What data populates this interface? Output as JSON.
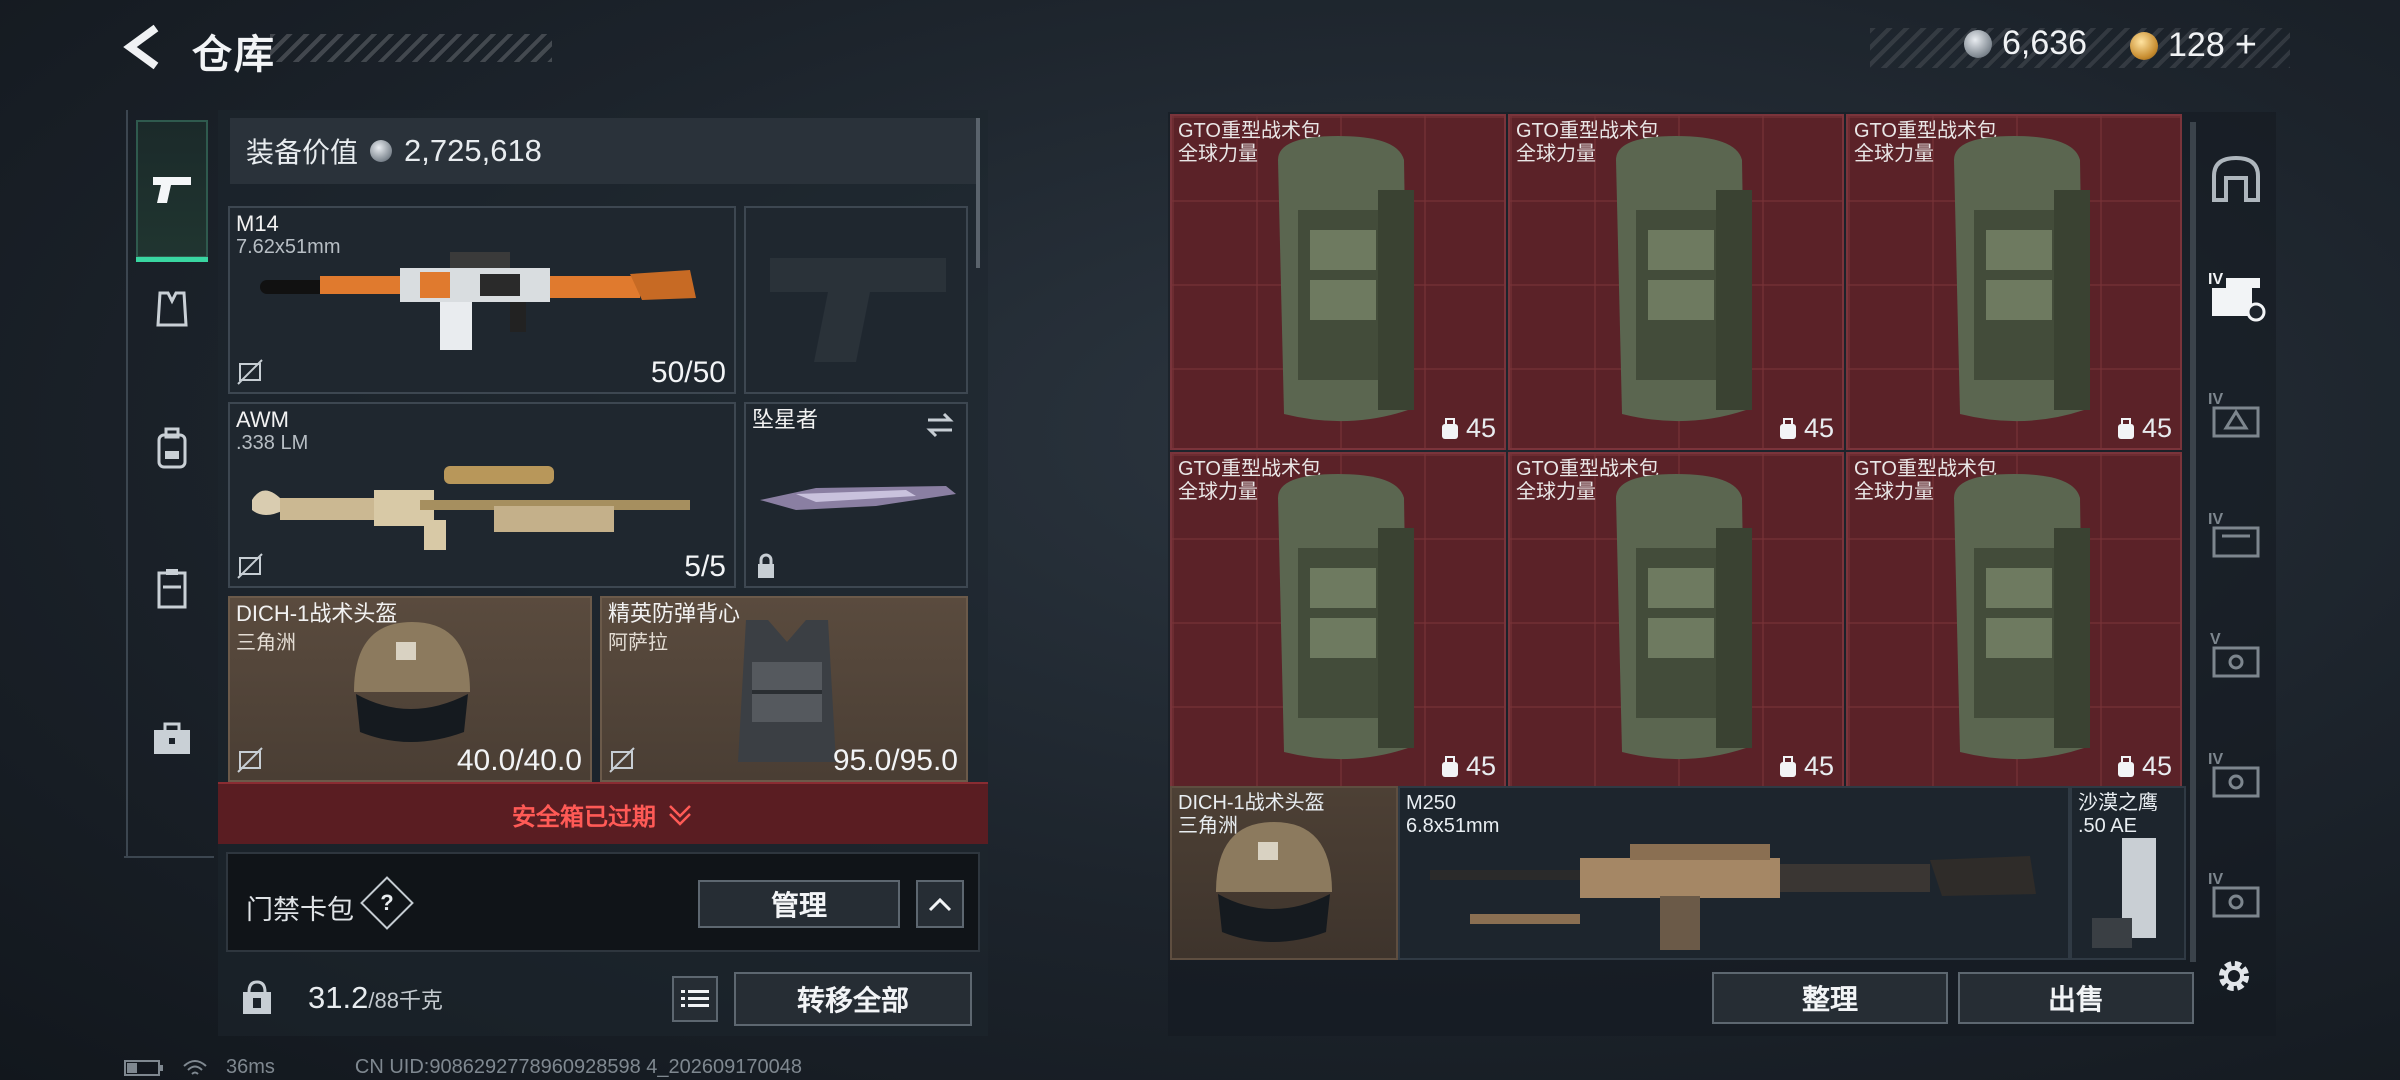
{
  "header": {
    "title": "仓库"
  },
  "currency": {
    "silver": "6,636",
    "gold": "128",
    "plus": "+"
  },
  "left_tabs": [
    {
      "name": "weapon"
    },
    {
      "name": "armor"
    },
    {
      "name": "backpack"
    },
    {
      "name": "vest"
    },
    {
      "name": "case"
    }
  ],
  "equipment_value": {
    "label": "装备价值",
    "value": "2,725,618"
  },
  "slots": {
    "primary": {
      "name": "M14",
      "caliber": "7.62x51mm",
      "ammo": "50/50"
    },
    "secondary": {
      "name": "AWM",
      "caliber": ".338 LM",
      "ammo": "5/5"
    },
    "melee": {
      "name": "坠星者"
    },
    "helmet": {
      "name": "DICH-1战术头盔",
      "brand": "三角洲",
      "durability": "40.0/40.0"
    },
    "armor": {
      "name": "精英防弹背心",
      "brand": "阿萨拉",
      "durability": "95.0/95.0"
    }
  },
  "safe_box": {
    "status": "安全箱已过期"
  },
  "key_card": {
    "label": "门禁卡包",
    "help": "?",
    "manage_label": "管理"
  },
  "weight": {
    "current": "31.2",
    "max": "/88千克"
  },
  "transfer_all_label": "转移全部",
  "storage": {
    "bags": [
      {
        "name": "GTO重型战术包",
        "brand": "全球力量",
        "capacity": "45"
      },
      {
        "name": "GTO重型战术包",
        "brand": "全球力量",
        "capacity": "45"
      },
      {
        "name": "GTO重型战术包",
        "brand": "全球力量",
        "capacity": "45"
      },
      {
        "name": "GTO重型战术包",
        "brand": "全球力量",
        "capacity": "45"
      },
      {
        "name": "GTO重型战术包",
        "brand": "全球力量",
        "capacity": "45"
      },
      {
        "name": "GTO重型战术包",
        "brand": "全球力量",
        "capacity": "45"
      }
    ],
    "helmet": {
      "name": "DICH-1战术头盔",
      "brand": "三角洲"
    },
    "lmg": {
      "name": "M250",
      "caliber": "6.8x51mm"
    },
    "pistol": {
      "name": "沙漠之鹰",
      "caliber": ".50 AE"
    }
  },
  "actions": {
    "sort_label": "整理",
    "sell_label": "出售"
  },
  "status_bar": {
    "ping": "36ms",
    "uid": "CN UID:9086292778960928598 4_202609170048"
  }
}
